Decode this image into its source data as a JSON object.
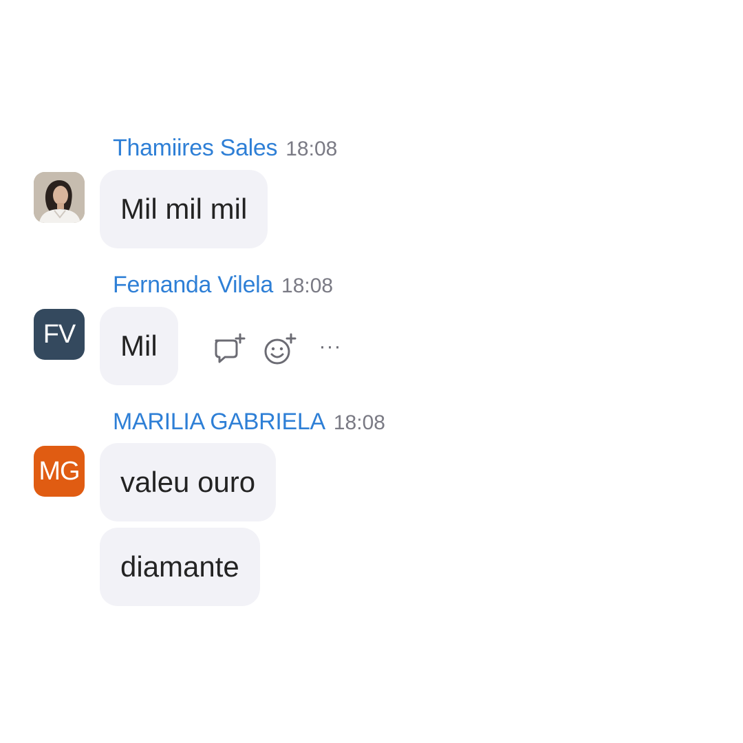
{
  "messages": [
    {
      "sender": "Thamiires Sales",
      "time": "18:08",
      "avatar": {
        "type": "photo",
        "icon": "user-photo-avatar",
        "color": "#b9ad9d"
      },
      "bubbles": [
        "Mil mil mil"
      ]
    },
    {
      "sender": "Fernanda Vilela",
      "time": "18:08",
      "avatar": {
        "type": "initials",
        "initials": "FV",
        "color": "#34495e"
      },
      "bubbles": [
        "Mil"
      ]
    },
    {
      "sender": "MARILIA GABRIELA",
      "time": "18:08",
      "avatar": {
        "type": "initials",
        "initials": "MG",
        "color": "#e05c12"
      },
      "bubbles": [
        "valeu ouro",
        "diamante"
      ]
    }
  ],
  "hover_actions": {
    "reply_icon": "reply-in-thread-icon",
    "reaction_icon": "add-reaction-icon",
    "more_label": "···"
  },
  "colors": {
    "sender_name": "#2e7fd6",
    "timestamp": "#7a7a84",
    "bubble_bg": "#f2f2f7",
    "text": "#232323",
    "icon": "#6b6b73"
  }
}
